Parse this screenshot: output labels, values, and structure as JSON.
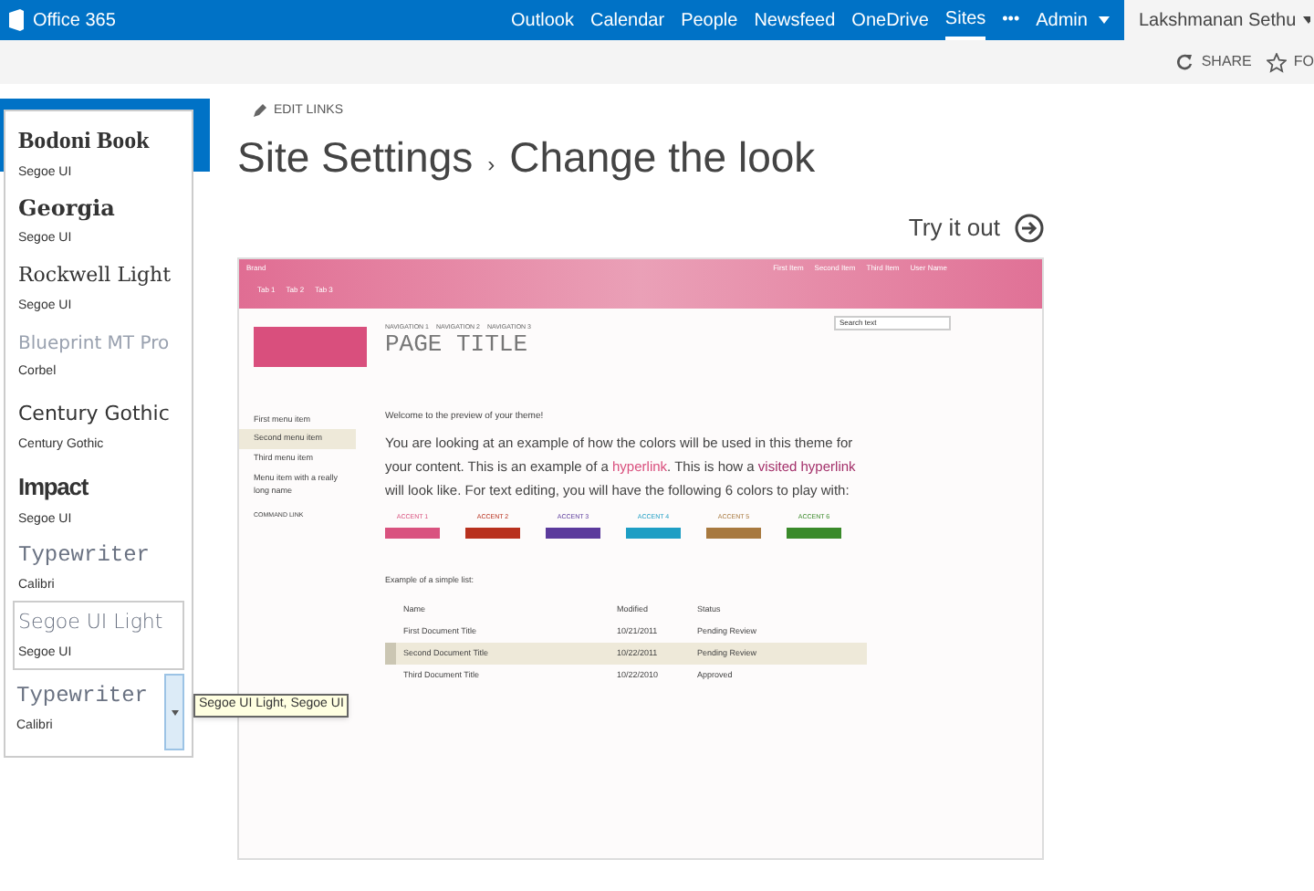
{
  "suite_bar": {
    "brand": "Office 365",
    "links": [
      {
        "label": "Outlook",
        "selected": false
      },
      {
        "label": "Calendar",
        "selected": false
      },
      {
        "label": "People",
        "selected": false
      },
      {
        "label": "Newsfeed",
        "selected": false
      },
      {
        "label": "OneDrive",
        "selected": false
      },
      {
        "label": "Sites",
        "selected": true
      }
    ],
    "more": "•••",
    "admin": "Admin",
    "user": "Lakshmanan Sethu"
  },
  "actions": [
    {
      "label": "SHARE",
      "kind": "share"
    },
    {
      "label": "FO",
      "kind": "follow"
    }
  ],
  "edit_links": "EDIT LINKS",
  "breadcrumb": {
    "parent": "Site Settings",
    "separator": "›",
    "current": "Change the look"
  },
  "try_it_out": "Try it out",
  "font_dropdown": {
    "options": [
      {
        "heading": "Bodoni Book",
        "body": "Segoe UI",
        "selected": false
      },
      {
        "heading": "Georgia",
        "body": "Segoe UI",
        "selected": false
      },
      {
        "heading": "Rockwell Light",
        "body": "Segoe UI",
        "selected": false
      },
      {
        "heading": "Blueprint MT Pro",
        "body": "Corbel",
        "selected": false
      },
      {
        "heading": "Century Gothic",
        "body": "Century Gothic",
        "selected": false
      },
      {
        "heading": "Impact",
        "body": "Segoe UI",
        "selected": false
      },
      {
        "heading": "Typewriter",
        "body": "Calibri",
        "selected": false
      },
      {
        "heading": "Segoe UI Light",
        "body": "Segoe UI",
        "selected": true
      }
    ],
    "value": {
      "heading": "Typewriter",
      "body": "Calibri"
    },
    "tooltip": "Segoe UI Light, Segoe UI"
  },
  "preview": {
    "brand": "Brand",
    "top_links": [
      "First Item",
      "Second Item",
      "Third Item",
      "User Name"
    ],
    "tabs": [
      "Tab 1",
      "Tab 2",
      "Tab 3"
    ],
    "navigation": [
      "NAVIGATION 1",
      "NAVIGATION 2",
      "NAVIGATION 3"
    ],
    "page_title": "PAGE TITLE",
    "search_placeholder": "Search text",
    "menu": [
      {
        "label": "First menu item",
        "selected": false
      },
      {
        "label": "Second menu item",
        "selected": true
      },
      {
        "label": "Third menu item",
        "selected": false
      },
      {
        "label": "Menu item with a really long name",
        "selected": false
      }
    ],
    "command_link": "COMMAND LINK",
    "welcome": "Welcome to the preview of your theme!",
    "paragraph": {
      "before": "You are looking at an example of how the colors will be used in this theme for your content. This is an example of a ",
      "hyperlink": "hyperlink",
      "middle": ". This is how a ",
      "visited": "visited hyperlink",
      "after": " will look like. For text editing, you will have the following 6 colors to play with:"
    },
    "accents": [
      {
        "label": "ACCENT 1",
        "color": "#d9527f"
      },
      {
        "label": "ACCENT 2",
        "color": "#b8311e"
      },
      {
        "label": "ACCENT 3",
        "color": "#5b3a9c"
      },
      {
        "label": "ACCENT 4",
        "color": "#1e9ec4"
      },
      {
        "label": "ACCENT 5",
        "color": "#a8793f"
      },
      {
        "label": "ACCENT 6",
        "color": "#3a8a2a"
      }
    ],
    "list_caption": "Example of a simple list:",
    "list": {
      "columns": [
        "Name",
        "Modified",
        "Status"
      ],
      "rows": [
        {
          "cells": [
            "First Document Title",
            "10/21/2011",
            "Pending Review"
          ],
          "selected": false
        },
        {
          "cells": [
            "Second Document Title",
            "10/22/2011",
            "Pending Review"
          ],
          "selected": true
        },
        {
          "cells": [
            "Third Document Title",
            "10/22/2010",
            "Approved"
          ],
          "selected": false
        }
      ]
    }
  }
}
